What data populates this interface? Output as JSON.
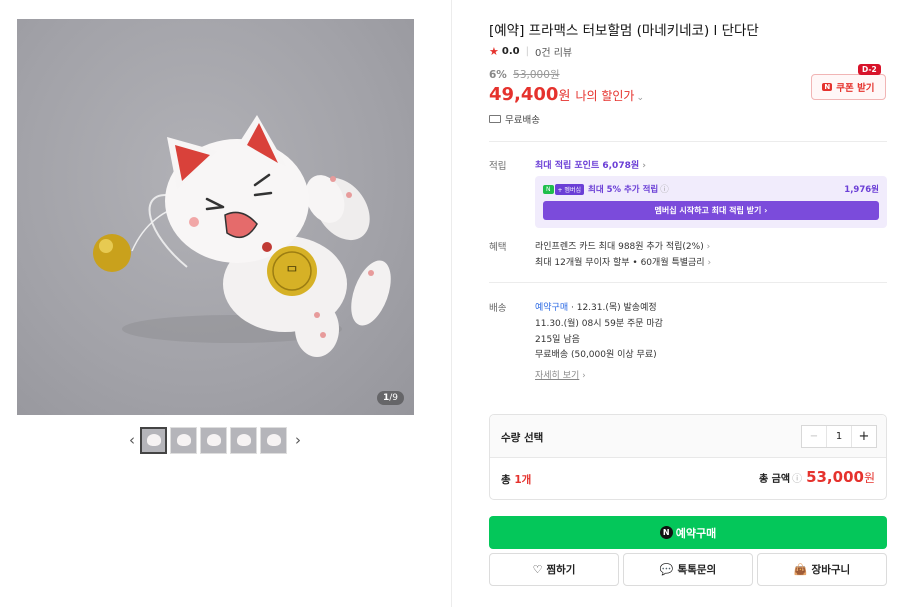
{
  "gallery": {
    "counter_current": "1",
    "counter_total": "/9",
    "thumbnail_count": 5
  },
  "product": {
    "title": "[예약] 프라맥스 터보할멈 (마네키네코) l 단다단",
    "rating": "0.0",
    "review_count": "0건 리뷰",
    "discount_pct": "6%",
    "original_price": "53,000원",
    "price": "49,400",
    "price_unit": "원",
    "my_discount": "나의 할인가",
    "shipping": "무료배송",
    "coupon_label": "쿠폰 받기",
    "coupon_dday": "D-2"
  },
  "points": {
    "label": "적립",
    "max_points_text": "최대 적립 포인트",
    "max_points_value": "6,078원",
    "membership_badge_n": "N",
    "membership_badge_plus": "+ 멤버십",
    "membership_rate": "최대 5% 추가 적립",
    "membership_amount": "1,976원",
    "membership_button": "멤버십 시작하고 최대 적립 받기"
  },
  "benefits": {
    "label": "혜택",
    "line1": "라인프렌즈 카드 최대 988원 추가 적립(2%)",
    "line2": "최대 12개월 무이자 할부 • 60개월 특별금리"
  },
  "delivery": {
    "label": "배송",
    "type": "예약구매",
    "ship_date": "· 12.31.(목) 발송예정",
    "deadline": "11.30.(월) 08시 59분 주문 마감",
    "remaining": "215일 남음",
    "free_shipping": "무료배송 (50,000원 이상 무료)",
    "detail_link": "자세히 보기"
  },
  "quantity": {
    "header": "수량 선택",
    "value": "1",
    "total_label": "총",
    "total_count": "1개",
    "sum_label": "총 금액",
    "sum_value": "53,000",
    "sum_unit": "원"
  },
  "actions": {
    "buy_label": "예약구매",
    "wish_label": "찜하기",
    "talk_label": "톡톡문의",
    "cart_label": "장바구니"
  },
  "colors": {
    "accent_red": "#e5322d",
    "buy_green": "#04c75a",
    "membership_purple": "#7b4bdb"
  }
}
